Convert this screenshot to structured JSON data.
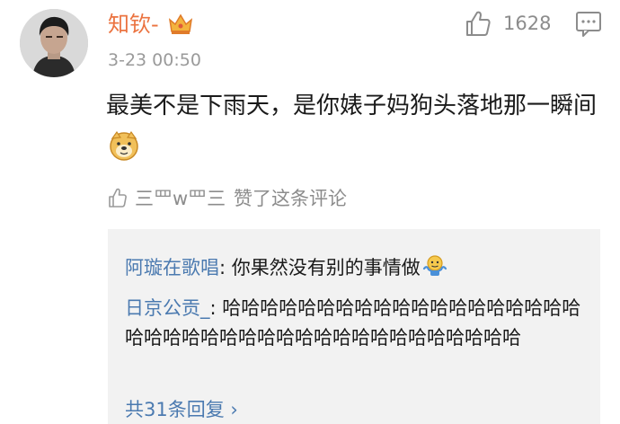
{
  "comment": {
    "username": "知钦-",
    "timestamp": "3-23 00:50",
    "like_count": "1628",
    "text": "最美不是下雨天，是你婊子妈狗头落地那一瞬间",
    "icons": {
      "avatar": "avatar",
      "badge": "crown-icon",
      "like": "thumb-up-icon",
      "comment": "comment-icon",
      "emoji": "doge-icon"
    },
    "liked_by": {
      "name": "三罒w罒三",
      "text": "赞了这条评论"
    }
  },
  "replies": {
    "items": [
      {
        "name": "阿璇在歌唱",
        "text": "你果然没有别的事情做",
        "emoji": "shrug-icon"
      },
      {
        "name": "日京公贡_",
        "text": "哈哈哈哈哈哈哈哈哈哈哈哈哈哈哈哈哈哈哈哈哈哈哈哈哈哈哈哈哈哈哈哈哈哈哈哈哈哈哈哈"
      }
    ],
    "more_label": "共31条回复 ›"
  },
  "colors": {
    "username": "#eb7340",
    "reply_name": "#4b7ab0",
    "reply_bg": "#f2f2f2",
    "meta": "#9a9a9a"
  }
}
